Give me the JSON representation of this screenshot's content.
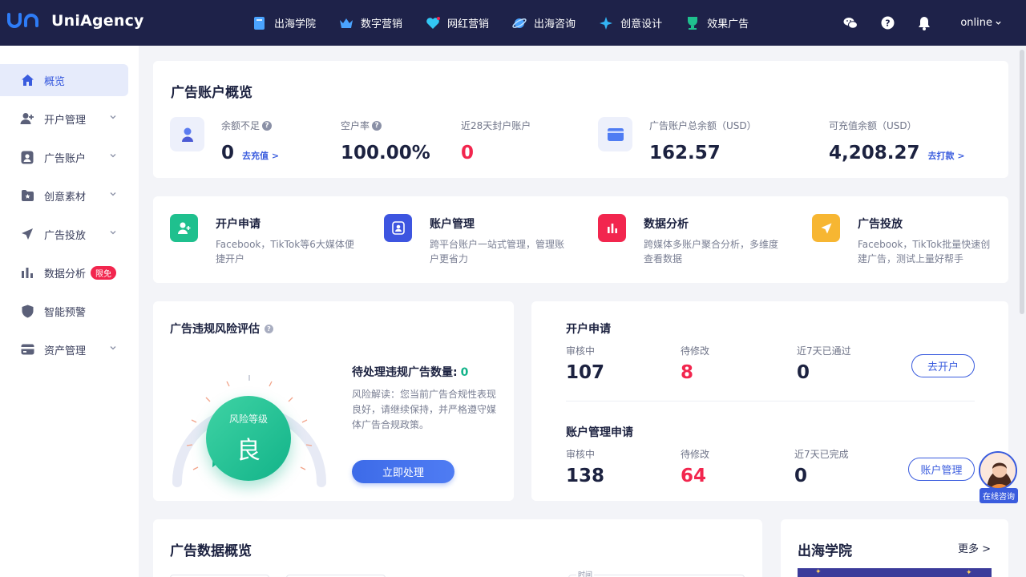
{
  "brand": {
    "name": "UniAgency"
  },
  "topnav": [
    {
      "label": "出海学院",
      "icon": "book-icon"
    },
    {
      "label": "数字营销",
      "icon": "crown-icon"
    },
    {
      "label": "网红营销",
      "icon": "heart-icon"
    },
    {
      "label": "出海咨询",
      "icon": "planet-icon"
    },
    {
      "label": "创意设计",
      "icon": "star-icon"
    },
    {
      "label": "效果广告",
      "icon": "trophy-icon"
    }
  ],
  "user": {
    "name": "online"
  },
  "sidebar": {
    "items": [
      {
        "label": "概览",
        "icon": "home-icon"
      },
      {
        "label": "开户管理",
        "icon": "user-add-icon"
      },
      {
        "label": "广告账户",
        "icon": "account-card-icon"
      },
      {
        "label": "创意素材",
        "icon": "creative-icon"
      },
      {
        "label": "广告投放",
        "icon": "send-icon"
      },
      {
        "label": "数据分析",
        "icon": "bar-chart-icon",
        "badge": "限免"
      },
      {
        "label": "智能预警",
        "icon": "shield-icon"
      },
      {
        "label": "资产管理",
        "icon": "wallet-icon"
      }
    ]
  },
  "overview": {
    "title": "广告账户概览",
    "insufficient": {
      "label": "余额不足",
      "value": "0",
      "link": "去充值 >"
    },
    "empty_rate": {
      "label": "空户率",
      "value": "100.00%"
    },
    "banned": {
      "label": "近28天封户账户",
      "value": "0"
    },
    "total_balance": {
      "label": "广告账户总余额（USD）",
      "value": "162.57"
    },
    "rechargeable": {
      "label": "可充值余额（USD）",
      "value": "4,208.27",
      "link": "去打款 >"
    }
  },
  "quicklinks": [
    {
      "title": "开户申请",
      "desc": "Facebook，TikTok等6大媒体便捷开户",
      "color": "#1fc08e"
    },
    {
      "title": "账户管理",
      "desc": "跨平台账户一站式管理，管理账户更省力",
      "color": "#3d55e0"
    },
    {
      "title": "数据分析",
      "desc": "跨媒体多账户聚合分析，多维度查看数据",
      "color": "#f2264e"
    },
    {
      "title": "广告投放",
      "desc": "Facebook，TikTok批量快速创建广告，测试上量好帮手",
      "color": "#f7b632"
    }
  ],
  "risk": {
    "title": "广告违规风险评估",
    "level_label": "风险等级",
    "level": "良",
    "pending_label": "待处理违规广告数量:",
    "pending_value": "0",
    "desc": "风险解读：您当前广告合规性表现良好，请继续保持，并严格遵守媒体广告合规政策。",
    "button": "立即处理"
  },
  "apps": {
    "open": {
      "title": "开户申请",
      "stats": [
        {
          "label": "审核中",
          "value": "107"
        },
        {
          "label": "待修改",
          "value": "8"
        },
        {
          "label": "近7天已通过",
          "value": "0"
        }
      ],
      "button": "去开户"
    },
    "manage": {
      "title": "账户管理申请",
      "stats": [
        {
          "label": "审核中",
          "value": "138"
        },
        {
          "label": "待修改",
          "value": "64"
        },
        {
          "label": "近7天已完成",
          "value": "0"
        }
      ],
      "button": "账户管理"
    }
  },
  "data_overview": {
    "title": "广告数据概览",
    "time_label": "时间"
  },
  "academy": {
    "title": "出海学院",
    "more": "更多 >"
  },
  "consult": {
    "label": "在线咨询"
  }
}
